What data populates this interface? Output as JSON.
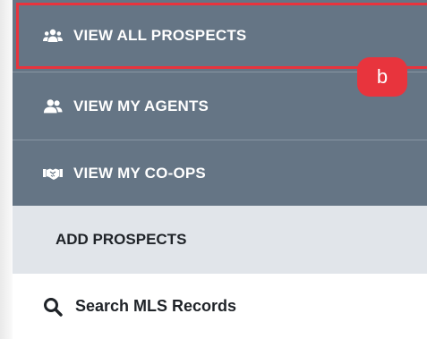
{
  "menu": {
    "items": [
      {
        "label": "VIEW ALL PROSPECTS",
        "icon": "users-group-icon"
      },
      {
        "label": "VIEW MY AGENTS",
        "icon": "users-icon"
      },
      {
        "label": "VIEW MY CO-OPS",
        "icon": "handshake-icon"
      }
    ],
    "section_header": "ADD PROSPECTS",
    "search_item": {
      "label": "Search MLS Records",
      "icon": "search-icon"
    }
  },
  "annotation": {
    "badge_label": "b"
  },
  "colors": {
    "menu_bg": "#657585",
    "section_bg": "#e1e5ea",
    "highlight": "#e8343d",
    "text_light": "#ffffff",
    "text_dark": "#1f2328"
  }
}
